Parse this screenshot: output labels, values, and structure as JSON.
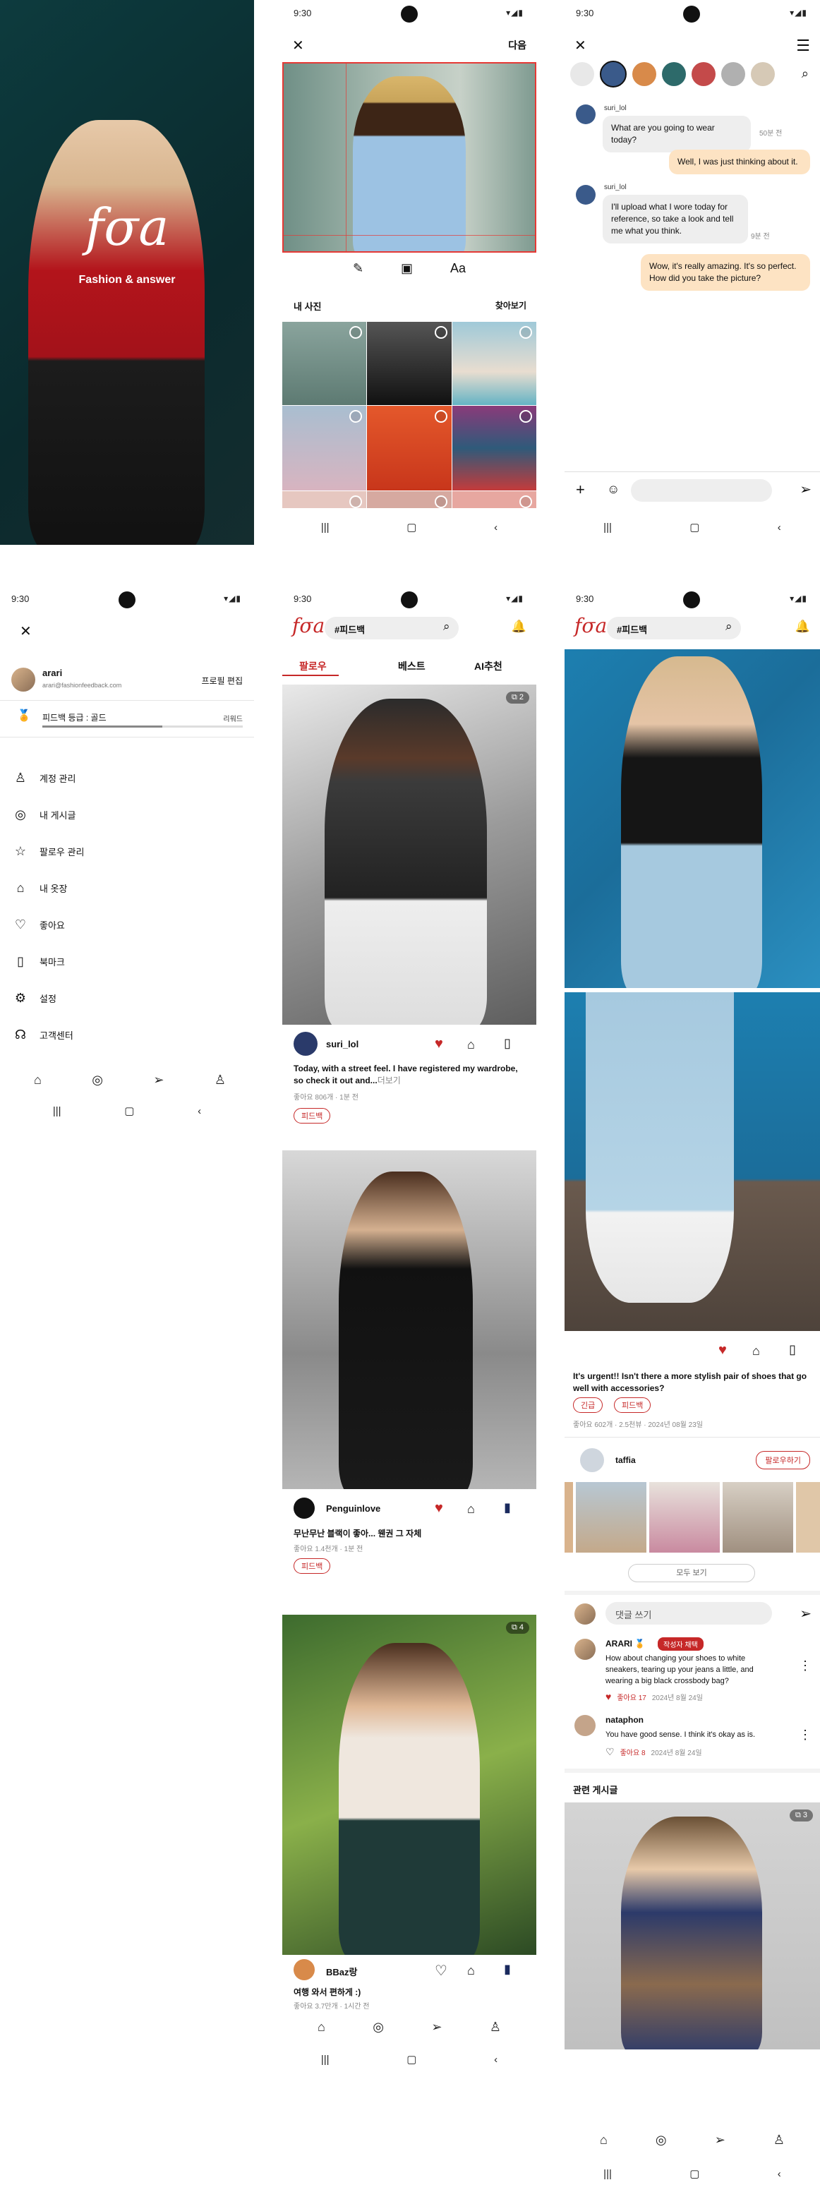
{
  "status": {
    "time": "9:30",
    "icons": "▾◢▮"
  },
  "splash": {
    "logo": "fσa",
    "tagline": "Fashion & answer"
  },
  "editor": {
    "close": "✕",
    "next": "다음",
    "tools": [
      "✎",
      "▣",
      "Aa"
    ],
    "my_photos": "내 사진",
    "browse": "찾아보기"
  },
  "chat": {
    "close": "✕",
    "messages": [
      {
        "side": "left",
        "user": "suri_lol",
        "text": "What are you going to wear today?",
        "time": "50분 전"
      },
      {
        "side": "right",
        "text": "Well, I was just thinking about it."
      },
      {
        "side": "left",
        "user": "suri_lol",
        "text": "I'll upload what I wore today for reference, so take a look and tell me what you think.",
        "time": "9분 전"
      },
      {
        "side": "right",
        "text": "Wow, it's really amazing. It's so perfect. How did you take the picture?"
      }
    ]
  },
  "menu": {
    "close": "✕",
    "username": "arari",
    "email": "arari@fashionfeedback.com",
    "edit_profile": "프로필 편집",
    "grade": "피드백 등급 : 골드",
    "reward": "리워드",
    "grade_progress": 0.6,
    "items": [
      "계정 관리",
      "내 게시글",
      "팔로우 관리",
      "내 옷장",
      "좋아요",
      "북마크",
      "설정",
      "고객센터"
    ]
  },
  "feed": {
    "search": "#피드백",
    "tabs": [
      "팔로우",
      "베스트",
      "AI추천"
    ],
    "posts": [
      {
        "user": "suri_lol",
        "text": "Today, with a street feel.  I have registered my wardrobe, so check it out and...",
        "more": "더보기",
        "meta": "좋아요 806개 · 1분 전",
        "tag": "피드백",
        "badge": "2"
      },
      {
        "user": "Penguinlove",
        "text": "무난무난 블랙이 좋아... 웬권 그 자체",
        "meta": "좋아요 1.4천개 · 1분 전",
        "tag": "피드백"
      },
      {
        "user": "BBaz랑",
        "text": "여행 와서 편하게 :)",
        "meta": "좋아요 3.7만개 · 1시간 전",
        "badge": "4"
      }
    ]
  },
  "detail": {
    "search": "#피드백",
    "question": "It's urgent!! Isn't there a more stylish pair of shoes that go well with accessories?",
    "tags": [
      "긴급",
      "피드백"
    ],
    "meta": "좋아요 602개 · 2.5천뷰 · 2024년 08월 23일",
    "author": "taffia",
    "follow": "팔로우하기",
    "see_all": "모두 보기",
    "comment_placeholder": "댓글 쓰기",
    "comments": [
      {
        "user": "ARARI 🏅",
        "badge": "작성자 채택",
        "text": "How about changing your shoes to white sneakers, tearing up your jeans a little, and wearing a big black crossbody bag?",
        "likes": "좋아요 17",
        "date": "2024년 8월 24일"
      },
      {
        "user": "nataphon",
        "text": "You have good sense. I think it's okay as is.",
        "likes": "좋아요 8",
        "date": "2024년 8월 24일"
      }
    ],
    "related": "관련 게시글",
    "related_badge": "3"
  },
  "nav_icons": [
    "⌂",
    "◎",
    "➢",
    "♙"
  ],
  "sys_icons": [
    "|||",
    "▢",
    "‹"
  ],
  "colors": {
    "accent": "#c62828",
    "navy": "#1a2a5e"
  }
}
